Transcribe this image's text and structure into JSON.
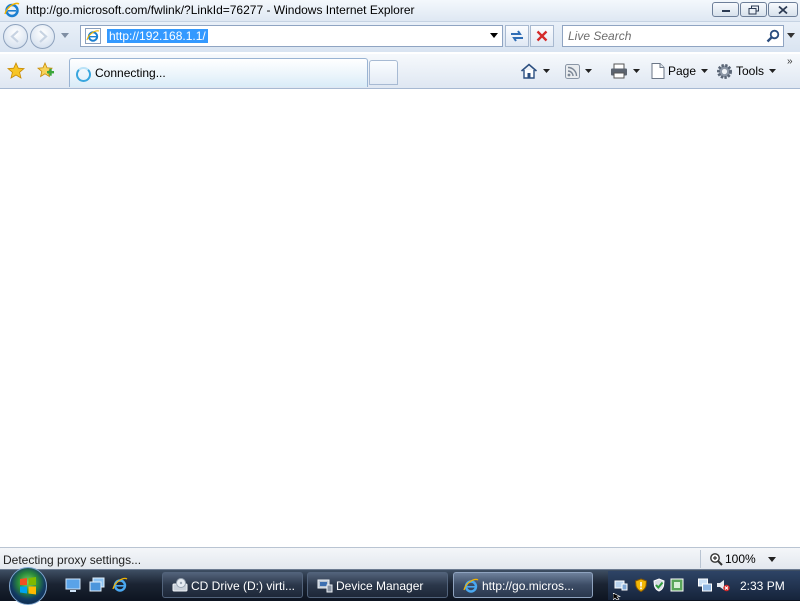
{
  "window": {
    "title": "http://go.microsoft.com/fwlink/?LinkId=76277 - Windows Internet Explorer",
    "minimize_label": "Minimize",
    "maximize_label": "Restore",
    "close_label": "Close"
  },
  "address_bar": {
    "url": "http://192.168.1.1/",
    "url_selected": true
  },
  "search": {
    "placeholder": "Live Search"
  },
  "tabs": [
    {
      "label": "Connecting...",
      "active": true,
      "loading": true
    }
  ],
  "command_bar": {
    "page_label": "Page",
    "tools_label": "Tools",
    "overflow": "»"
  },
  "status_bar": {
    "text": "Detecting proxy settings...",
    "zoom": "100%"
  },
  "taskbar": {
    "buttons": [
      {
        "label": "CD Drive (D:) virti...",
        "icon": "cd-drive-icon"
      },
      {
        "label": "Device Manager",
        "icon": "device-manager-icon"
      },
      {
        "label": "http://go.micros...",
        "icon": "ie-icon",
        "active": true
      }
    ],
    "clock": "2:33 PM"
  },
  "colors": {
    "selection": "#3399ff",
    "taskbar": "#1b2433",
    "loading_accent": "#37a6de"
  }
}
